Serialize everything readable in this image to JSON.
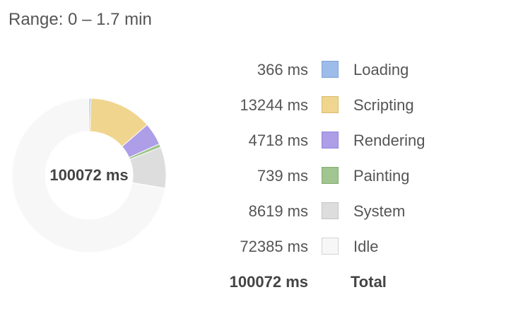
{
  "range_label": "Range: 0 – 1.7 min",
  "donut_center": "100072 ms",
  "chart_data": {
    "type": "pie",
    "categories": [
      "Loading",
      "Scripting",
      "Rendering",
      "Painting",
      "System",
      "Idle"
    ],
    "values": [
      366,
      13244,
      4718,
      739,
      8619,
      72385
    ],
    "units": "ms",
    "total": 100072
  },
  "legend": [
    {
      "value": "366 ms",
      "label": "Loading",
      "color": "#9dbcea",
      "border": "#7ea2d6"
    },
    {
      "value": "13244 ms",
      "label": "Scripting",
      "color": "#f0d58e",
      "border": "#d9bb6c"
    },
    {
      "value": "4718 ms",
      "label": "Rendering",
      "color": "#ae9ee8",
      "border": "#9482d6"
    },
    {
      "value": "739 ms",
      "label": "Painting",
      "color": "#a1c590",
      "border": "#83ab70"
    },
    {
      "value": "8619 ms",
      "label": "System",
      "color": "#dddddd",
      "border": "#c4c4c4"
    },
    {
      "value": "72385 ms",
      "label": "Idle",
      "color": "#f7f7f7",
      "border": "#d4d4d4"
    }
  ],
  "total": {
    "value": "100072 ms",
    "label": "Total"
  }
}
